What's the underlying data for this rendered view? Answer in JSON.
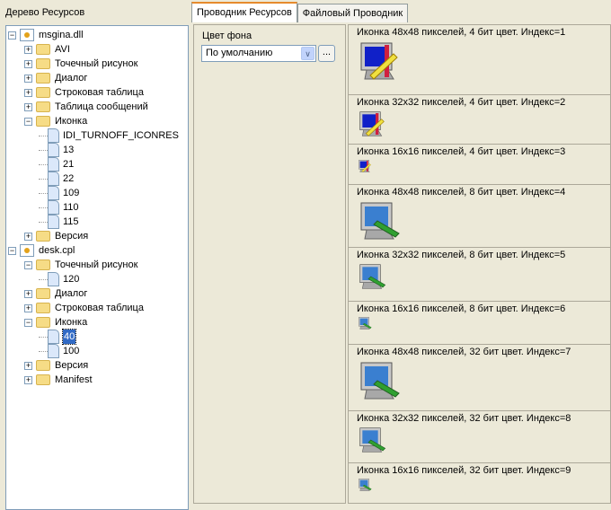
{
  "left_header": "Дерево Ресурсов",
  "tree": [
    {
      "label": "msgina.dll",
      "level": 0,
      "type": "dll",
      "exp": "-"
    },
    {
      "label": "AVI",
      "level": 1,
      "type": "folder",
      "exp": "+"
    },
    {
      "label": "Точечный рисунок",
      "level": 1,
      "type": "folder",
      "exp": "+"
    },
    {
      "label": "Диалог",
      "level": 1,
      "type": "folder",
      "exp": "+"
    },
    {
      "label": "Строковая таблица",
      "level": 1,
      "type": "folder",
      "exp": "+"
    },
    {
      "label": "Таблица сообщений",
      "level": 1,
      "type": "folder",
      "exp": "+"
    },
    {
      "label": "Иконка",
      "level": 1,
      "type": "folder",
      "exp": "-"
    },
    {
      "label": "IDI_TURNOFF_ICONRES",
      "level": 2,
      "type": "doc"
    },
    {
      "label": "13",
      "level": 2,
      "type": "doc"
    },
    {
      "label": "21",
      "level": 2,
      "type": "doc"
    },
    {
      "label": "22",
      "level": 2,
      "type": "doc"
    },
    {
      "label": "109",
      "level": 2,
      "type": "doc"
    },
    {
      "label": "110",
      "level": 2,
      "type": "doc"
    },
    {
      "label": "115",
      "level": 2,
      "type": "doc"
    },
    {
      "label": "Версия",
      "level": 1,
      "type": "folder",
      "exp": "+"
    },
    {
      "label": "desk.cpl",
      "level": 0,
      "type": "dll",
      "exp": "-"
    },
    {
      "label": "Точечный рисунок",
      "level": 1,
      "type": "folder",
      "exp": "-"
    },
    {
      "label": "120",
      "level": 2,
      "type": "doc"
    },
    {
      "label": "Диалог",
      "level": 1,
      "type": "folder",
      "exp": "+"
    },
    {
      "label": "Строковая таблица",
      "level": 1,
      "type": "folder",
      "exp": "+"
    },
    {
      "label": "Иконка",
      "level": 1,
      "type": "folder",
      "exp": "-"
    },
    {
      "label": "40",
      "level": 2,
      "type": "doc",
      "selected": true
    },
    {
      "label": "100",
      "level": 2,
      "type": "doc"
    },
    {
      "label": "Версия",
      "level": 1,
      "type": "folder",
      "exp": "+"
    },
    {
      "label": "Manifest",
      "level": 1,
      "type": "folder",
      "exp": "+"
    }
  ],
  "tabs": [
    {
      "label": "Проводник Ресурсов",
      "active": true
    },
    {
      "label": "Файловый Проводник",
      "active": false
    }
  ],
  "options": {
    "bg_label": "Цвет фона",
    "bg_value": "По умолчанию",
    "browse_label": "..."
  },
  "icons": [
    {
      "title": "Иконка 48x48 пикселей, 4 бит цвет. Индекс=1",
      "size": 48,
      "kind": "monitor-ruler"
    },
    {
      "title": "Иконка 32x32 пикселей, 4 бит цвет. Индекс=2",
      "size": 32,
      "kind": "monitor-ruler"
    },
    {
      "title": "Иконка 16x16 пикселей, 4 бит цвет. Индекс=3",
      "size": 16,
      "kind": "monitor-ruler"
    },
    {
      "title": "Иконка 48x48 пикселей, 8 бит цвет. Индекс=4",
      "size": 48,
      "kind": "monitor-brush"
    },
    {
      "title": "Иконка 32x32 пикселей, 8 бит цвет. Индекс=5",
      "size": 32,
      "kind": "monitor-brush"
    },
    {
      "title": "Иконка 16x16 пикселей, 8 бит цвет. Индекс=6",
      "size": 16,
      "kind": "monitor-brush"
    },
    {
      "title": "Иконка 48x48 пикселей, 32 бит цвет. Индекс=7",
      "size": 48,
      "kind": "monitor-brush"
    },
    {
      "title": "Иконка 32x32 пикселей, 32 бит цвет. Индекс=8",
      "size": 32,
      "kind": "monitor-brush"
    },
    {
      "title": "Иконка 16x16 пикселей, 32 бит цвет. Индекс=9",
      "size": 16,
      "kind": "monitor-brush"
    }
  ]
}
